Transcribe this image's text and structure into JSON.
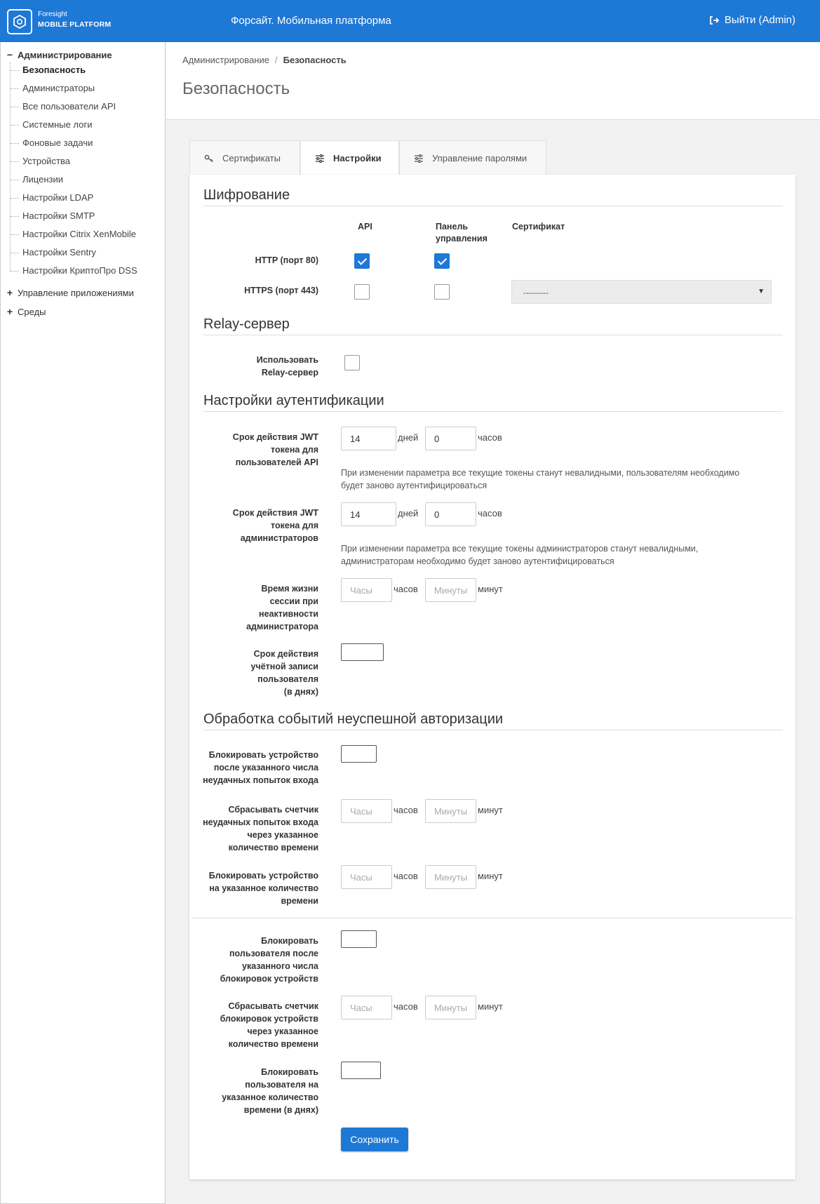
{
  "header": {
    "logo_line1": "Foresight",
    "logo_line2": "MOBILE PLATFORM",
    "title": "Форсайт. Мобильная платформа",
    "logout_label": "Выйти (Admin)",
    "brand_color": "#1e78d6"
  },
  "sidebar": {
    "admin_group": "Администрирование",
    "items": [
      "Безопасность",
      "Администраторы",
      "Все пользователи API",
      "Системные логи",
      "Фоновые задачи",
      "Устройства",
      "Лицензии",
      "Настройки LDAP",
      "Настройки SMTP",
      "Настройки Citrix XenMobile",
      "Настройки Sentry",
      "Настройки КриптоПро DSS"
    ],
    "active_item": "Безопасность",
    "apps_group": "Управление приложениями",
    "env_group": "Среды",
    "expanded_sign": "−",
    "collapsed_sign": "+"
  },
  "breadcrumb": {
    "root": "Администрирование",
    "separator": "/",
    "current": "Безопасность"
  },
  "page_title": "Безопасность",
  "tabs": {
    "certificates": "Сертификаты",
    "settings": "Настройки",
    "passwords": "Управление паролями",
    "active": "Настройки"
  },
  "encryption": {
    "title": "Шифрование",
    "col_api": "API",
    "col_panel_l1": "Панель",
    "col_panel_l2": "управления",
    "col_cert": "Сертификат",
    "http_label": "HTTP (порт 80)",
    "https_label": "HTTPS (порт 443)",
    "http_api_checked": true,
    "http_panel_checked": true,
    "https_api_checked": false,
    "https_panel_checked": false,
    "cert_selected": "---------"
  },
  "relay": {
    "title": "Relay-сервер",
    "use_label_l1": "Использовать",
    "use_label_l2": "Relay-сервер",
    "checked": false
  },
  "auth": {
    "title": "Настройки аутентификации",
    "jwt_api_label": [
      "Срок действия JWT",
      "токена для",
      "пользователей API"
    ],
    "jwt_api_days": "14",
    "jwt_api_hours": "0",
    "jwt_api_hint_l1": "При изменении параметра все текущие токены станут невалидными, пользователям необходимо",
    "jwt_api_hint_l2": "будет заново аутентифицироваться",
    "jwt_admin_label": [
      "Срок действия JWT",
      "токена для",
      "администраторов"
    ],
    "jwt_admin_days": "14",
    "jwt_admin_hours": "0",
    "jwt_admin_hint_l1": "При изменении параметра все текущие токены администраторов станут невалидными,",
    "jwt_admin_hint_l2": "администраторам необходимо будет заново аутентифицироваться",
    "session_label": [
      "Время жизни",
      "сессии при",
      "неактивности",
      "администратора"
    ],
    "session_hours_placeholder": "Часы",
    "session_minutes_placeholder": "Минуты",
    "account_label": [
      "Срок действия",
      "учётной записи",
      "пользователя",
      "(в днях)"
    ],
    "unit_days": "дней",
    "unit_hours": "часов",
    "unit_minutes": "минут"
  },
  "failed_auth": {
    "title": "Обработка событий неуспешной авторизации",
    "block_device_label": [
      "Блокировать устройство",
      "после указанного числа",
      "неудачных попыток входа"
    ],
    "reset_counter_label": [
      "Сбрасывать счетчик",
      "неудачных попыток входа",
      "через указанное",
      "количество времени"
    ],
    "block_device_time_label": [
      "Блокировать устройство",
      "на указанное количество",
      "времени"
    ],
    "block_user_label": [
      "Блокировать",
      "пользователя после",
      "указанного числа",
      "блокировок устройств"
    ],
    "reset_block_counter_label": [
      "Сбрасывать счетчик",
      "блокировок устройств",
      "через указанное",
      "количество времени"
    ],
    "block_user_time_label": [
      "Блокировать",
      "пользователя на",
      "указанное количество",
      "времени (в днях)"
    ],
    "hours_placeholder": "Часы",
    "minutes_placeholder": "Минуты"
  },
  "save_label": "Сохранить"
}
